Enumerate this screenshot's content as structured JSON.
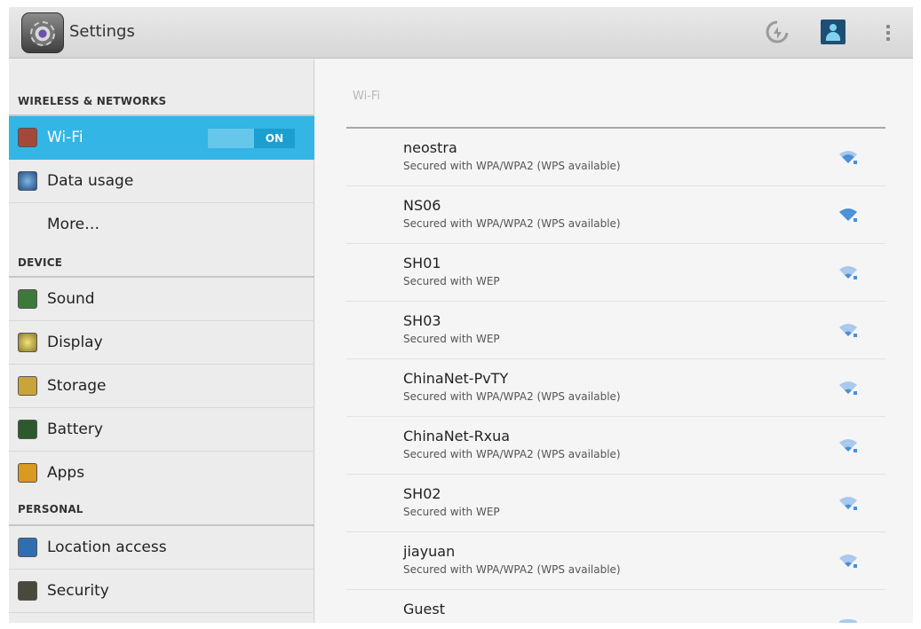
{
  "actionbar": {
    "title": "Settings",
    "icons": [
      "settings-app-icon",
      "sync-icon",
      "account-icon",
      "overflow-menu-icon"
    ]
  },
  "sidebar": {
    "sections": [
      {
        "header": "WIRELESS & NETWORKS",
        "items": [
          {
            "label": "Wi-Fi",
            "icon": "wifi-icon",
            "selected": true,
            "toggle": "ON"
          },
          {
            "label": "Data usage",
            "icon": "data-usage-icon"
          },
          {
            "label": "More…",
            "icon": ""
          }
        ]
      },
      {
        "header": "DEVICE",
        "items": [
          {
            "label": "Sound",
            "icon": "sound-icon"
          },
          {
            "label": "Display",
            "icon": "display-icon"
          },
          {
            "label": "Storage",
            "icon": "storage-icon"
          },
          {
            "label": "Battery",
            "icon": "battery-icon"
          },
          {
            "label": "Apps",
            "icon": "apps-icon"
          }
        ]
      },
      {
        "header": "PERSONAL",
        "items": [
          {
            "label": "Location access",
            "icon": "location-icon"
          },
          {
            "label": "Security",
            "icon": "lock-icon"
          }
        ]
      }
    ]
  },
  "detail": {
    "title": "Wi-Fi",
    "networks": [
      {
        "name": "neostra",
        "security": "Secured with WPA/WPA2 (WPS available)"
      },
      {
        "name": "NS06",
        "security": "Secured with WPA/WPA2 (WPS available)"
      },
      {
        "name": "SH01",
        "security": "Secured with WEP"
      },
      {
        "name": "SH03",
        "security": "Secured with WEP"
      },
      {
        "name": "ChinaNet-PvTY",
        "security": "Secured with WPA/WPA2 (WPS available)"
      },
      {
        "name": "ChinaNet-Rxua",
        "security": "Secured with WPA/WPA2 (WPS available)"
      },
      {
        "name": "SH02",
        "security": "Secured with WEP"
      },
      {
        "name": "jiayuan",
        "security": "Secured with WPA/WPA2 (WPS available)"
      },
      {
        "name": "Guest",
        "security": ""
      }
    ]
  },
  "colors": {
    "accent": "#33b5e5",
    "signal": "#4a8fd8",
    "signal_dim": "#a9c9ec"
  }
}
